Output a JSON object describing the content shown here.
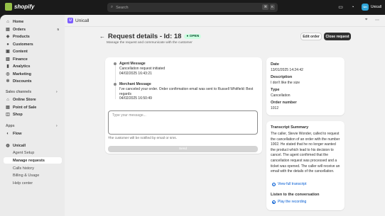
{
  "topbar": {
    "brand": "shopify",
    "search_placeholder": "Search",
    "shortcut_keys": [
      "⌘",
      "K"
    ],
    "store_name": "Unicall",
    "avatar_initials": "Un"
  },
  "sidebar": {
    "items": [
      {
        "label": "Home",
        "icon": "home-icon"
      },
      {
        "label": "Orders",
        "icon": "orders-icon",
        "badge": "5"
      },
      {
        "label": "Products",
        "icon": "tag-icon"
      },
      {
        "label": "Customers",
        "icon": "person-icon"
      },
      {
        "label": "Content",
        "icon": "content-icon"
      },
      {
        "label": "Finance",
        "icon": "bank-icon"
      },
      {
        "label": "Analytics",
        "icon": "chart-icon"
      },
      {
        "label": "Marketing",
        "icon": "target-icon"
      },
      {
        "label": "Discounts",
        "icon": "discount-icon"
      }
    ],
    "sales_channels_label": "Sales channels",
    "channels": [
      {
        "label": "Online Store",
        "icon": "store-icon"
      },
      {
        "label": "Point of Sale",
        "icon": "pos-icon"
      },
      {
        "label": "Shop",
        "icon": "shop-icon"
      }
    ],
    "apps_label": "Apps",
    "apps": [
      {
        "label": "Flow",
        "icon": "flow-icon"
      }
    ],
    "app_name": "Unicall",
    "app_subitems": [
      "Agent Setup",
      "Manage requests",
      "Calls history",
      "Billing & Usage",
      "Help center"
    ]
  },
  "appbar": {
    "name": "Unicall"
  },
  "page": {
    "title": "Request details - Id: 18",
    "status": "OPEN",
    "subtitle": "Manage the request and communicate with the customer",
    "edit_order": "Edit order",
    "close_request": "Close request"
  },
  "timeline": [
    {
      "title": "Agent Message",
      "body": "Cancellation request initiated",
      "time": "04/02/2025 16:43:21"
    },
    {
      "title": "Merchant Message",
      "body": "I've canceled your order. Order confirmation email was sent to Russell Whitfield: Best regards",
      "time": "04/02/2025 16:50:49"
    }
  ],
  "compose": {
    "placeholder": "Type your message...",
    "notice": "The customer will be notified by email or sms.",
    "send": "Send"
  },
  "details": {
    "date_label": "Date",
    "date": "13/01/2025 14:24:42",
    "description_label": "Description",
    "description": "I don't like the size",
    "type_label": "Type",
    "type": "Cancellation",
    "order_label": "Order number",
    "order": "1012"
  },
  "transcript": {
    "title": "Transcript Summary",
    "summary": "The caller, Stevie Wonder, called to request the cancellation of an order with the number 1002. He stated that he no longer wanted the product which lead to his decision to cancel. The agent confirmed that the cancellation request was processed and a ticket was opened. The caller will receive an email with the details of the cancellation.",
    "view_link": "View full transcript",
    "listen_title": "Listen to the conversation",
    "play_link": "Play the recording"
  }
}
